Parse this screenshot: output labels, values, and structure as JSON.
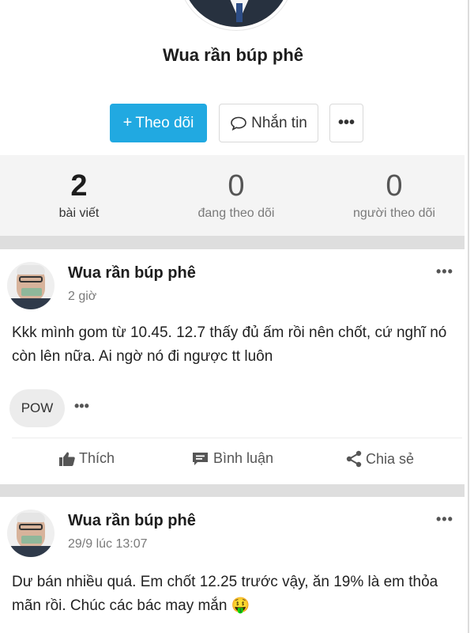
{
  "profile": {
    "name": "Wua rần búp phê",
    "buttons": {
      "follow": "Theo dõi",
      "follow_icon": "+",
      "message": "Nhắn tin",
      "more": "•••"
    }
  },
  "stats": [
    {
      "value": "2",
      "label": "bài viết"
    },
    {
      "value": "0",
      "label": "đang theo dõi"
    },
    {
      "value": "0",
      "label": "người theo dõi"
    }
  ],
  "posts": [
    {
      "author": "Wua rần búp phê",
      "time": "2 giờ",
      "content": "Kkk mình gom từ 10.45. 12.7 thấy đủ ấm rồi nên chốt, cứ nghĩ nó còn lên nữa. Ai ngờ nó đi ngược tt luôn",
      "tag": "POW",
      "actions": {
        "like": "Thích",
        "comment": "Bình luận",
        "share": "Chia sẻ"
      }
    },
    {
      "author": "Wua rần búp phê",
      "time": "29/9 lúc 13:07",
      "content": "Dư bán nhiều quá. Em chốt 12.25 trước vậy, ăn 19% là em thỏa mãn rồi. Chúc các bác may mắn 🤑"
    }
  ],
  "icons": {
    "follow": "plus-icon",
    "message": "speech-bubble-icon",
    "like": "thumbs-up-icon",
    "comment": "comment-icon",
    "share": "share-icon",
    "more": "ellipsis-icon"
  },
  "colors": {
    "accent": "#21a9e1",
    "stats_background": "#f4f4f4",
    "separator": "#dedede",
    "muted_text": "#7a7a7a"
  }
}
